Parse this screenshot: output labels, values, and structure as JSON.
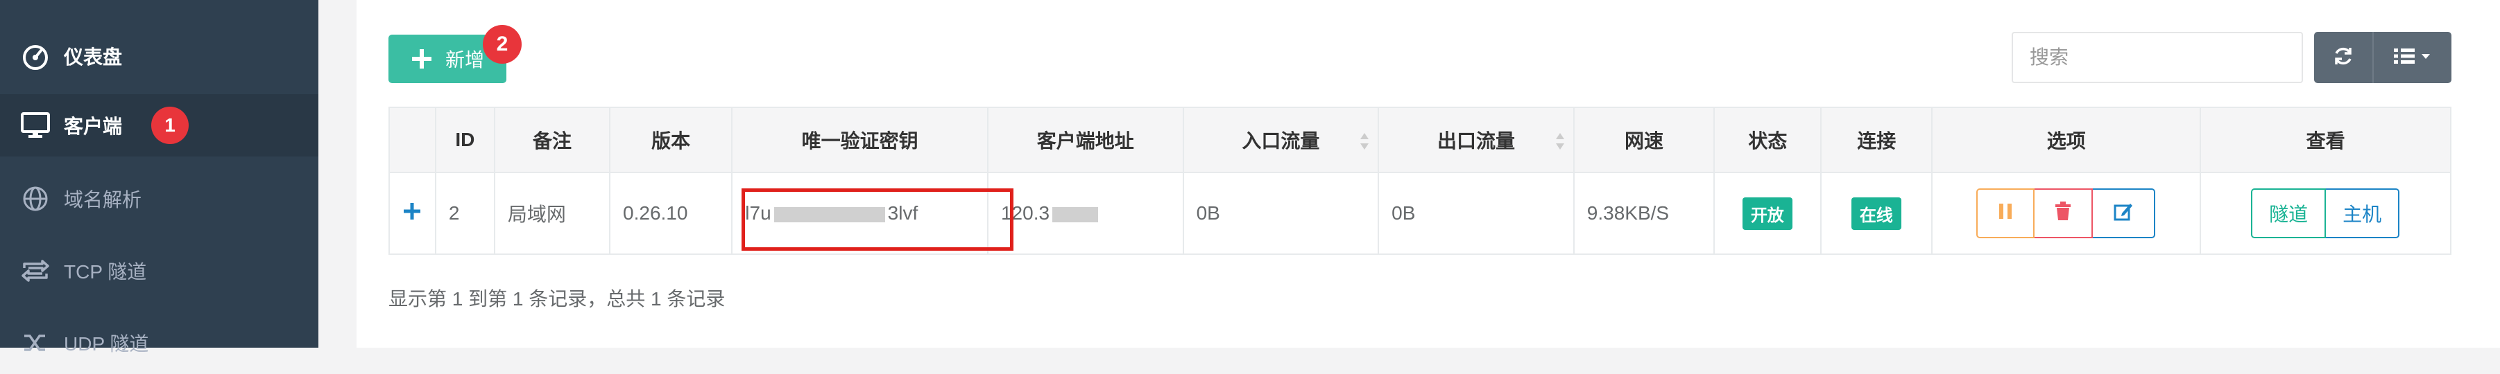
{
  "sidebar": {
    "items": [
      {
        "label": "仪表盘",
        "icon": "dashboard-icon"
      },
      {
        "label": "客户端",
        "icon": "monitor-icon",
        "badge": "1"
      },
      {
        "label": "域名解析",
        "icon": "globe-icon"
      },
      {
        "label": "TCP 隧道",
        "icon": "retweet-icon"
      },
      {
        "label": "UDP 隧道",
        "icon": "random-icon"
      }
    ]
  },
  "toolbar": {
    "add_label": "新增",
    "add_badge": "2",
    "search_placeholder": "搜索",
    "refresh_icon": "refresh-icon",
    "columns_icon": "list-icon"
  },
  "table": {
    "headers": [
      "",
      "ID",
      "备注",
      "版本",
      "唯一验证密钥",
      "客户端地址",
      "入口流量",
      "出口流量",
      "网速",
      "状态",
      "连接",
      "选项",
      "查看"
    ],
    "rows": [
      {
        "id": "2",
        "remark": "局域网",
        "version": "0.26.10",
        "key_start": "l7u",
        "key_end": "3lvf",
        "address": "120.3",
        "in_flow": "0B",
        "out_flow": "0B",
        "speed": "9.38KB/S",
        "status": "开放",
        "connect": "在线",
        "view_tunnel": "隧道",
        "view_host": "主机"
      }
    ]
  },
  "footer": {
    "summary": "显示第 1 到第 1 条记录，总共 1 条记录"
  },
  "colors": {
    "sidebar_bg": "#2f4050",
    "primary": "#1ab394",
    "danger": "#ed5565",
    "warning": "#f8ac59",
    "info": "#1c84c6",
    "highlight": "#e0201b"
  }
}
